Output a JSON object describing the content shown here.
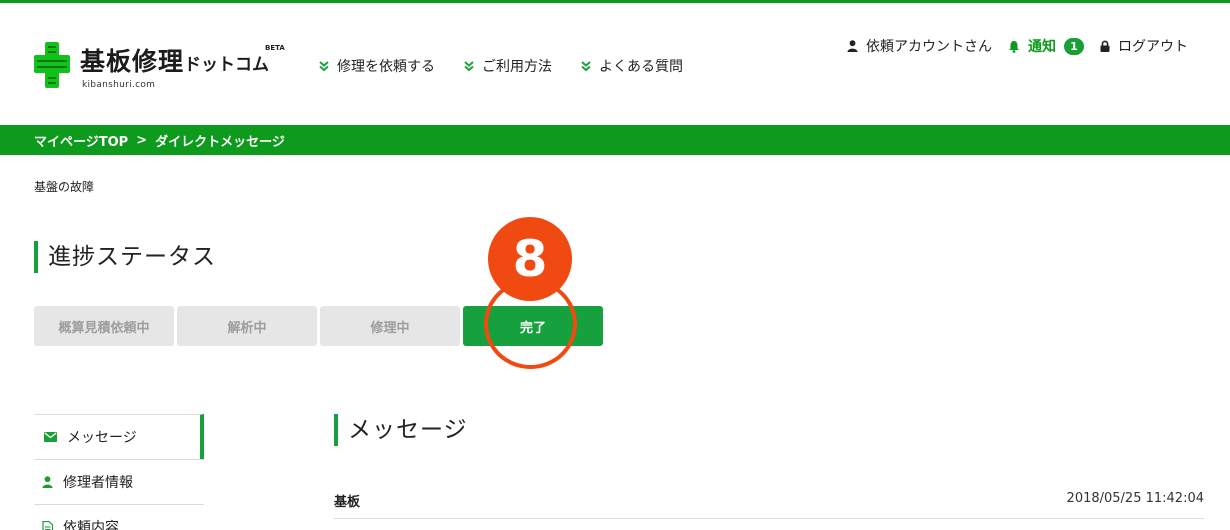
{
  "brand": {
    "title_main": "基板修理",
    "title_small": "ドットコム",
    "beta": "BETA",
    "url": "kibanshuri.com",
    "color": "#0e9a1c"
  },
  "nav": {
    "items": [
      {
        "label": "修理を依頼する",
        "icon": "chevron-double-down-icon"
      },
      {
        "label": "ご利用方法",
        "icon": "chevron-double-down-icon"
      },
      {
        "label": "よくある質問",
        "icon": "chevron-double-down-icon"
      }
    ]
  },
  "account": {
    "user": "依頼アカウントさん",
    "user_icon": "user-icon",
    "notify_label": "通知",
    "notify_icon": "bell-icon",
    "notify_count": "1",
    "logout": "ログアウト",
    "logout_icon": "lock-icon"
  },
  "breadcrumb": {
    "home": "マイページTOP",
    "sep": ">",
    "current": "ダイレクトメッセージ"
  },
  "case_title": "基盤の故障",
  "progress": {
    "heading": "進捗ステータス",
    "steps": [
      "概算見積依頼中",
      "解析中",
      "修理中",
      "完了"
    ],
    "active_step": "完了",
    "active_color": "#17a03e"
  },
  "annotation": {
    "number": "8",
    "color": "#f04a12"
  },
  "sidebar": {
    "items": [
      {
        "label": "メッセージ",
        "icon": "envelope-icon"
      },
      {
        "label": "修理者情報",
        "icon": "user-icon"
      },
      {
        "label": "依頼内容",
        "icon": "document-icon"
      }
    ]
  },
  "messages": {
    "heading": "メッセージ",
    "rows": [
      {
        "sender": "基板",
        "time": "2018/05/25 11:42:04"
      }
    ]
  }
}
